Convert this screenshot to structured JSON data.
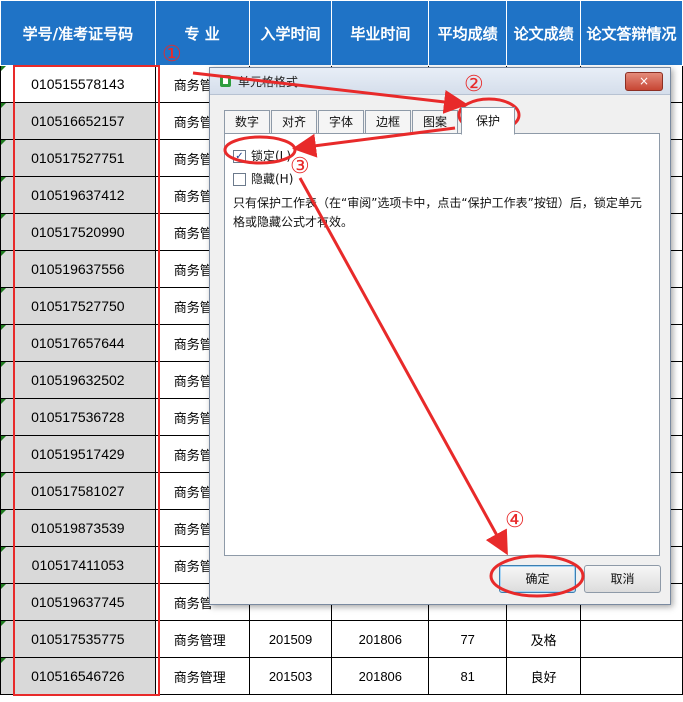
{
  "table": {
    "headers": [
      "学号/准考证号码",
      "专  业",
      "入学时间",
      "毕业时间",
      "平均成绩",
      "论文成绩",
      "论文答辩情况"
    ],
    "rows": [
      {
        "id": "010515578143",
        "major": "商务管",
        "entry": "",
        "grad": "",
        "avg": "",
        "thesis": ""
      },
      {
        "id": "010516652157",
        "major": "商务管",
        "entry": "",
        "grad": "",
        "avg": "",
        "thesis": ""
      },
      {
        "id": "010517527751",
        "major": "商务管",
        "entry": "",
        "grad": "",
        "avg": "",
        "thesis": ""
      },
      {
        "id": "010519637412",
        "major": "商务管",
        "entry": "",
        "grad": "",
        "avg": "",
        "thesis": ""
      },
      {
        "id": "010517520990",
        "major": "商务管",
        "entry": "",
        "grad": "",
        "avg": "",
        "thesis": ""
      },
      {
        "id": "010519637556",
        "major": "商务管",
        "entry": "",
        "grad": "",
        "avg": "",
        "thesis": ""
      },
      {
        "id": "010517527750",
        "major": "商务管",
        "entry": "",
        "grad": "",
        "avg": "",
        "thesis": ""
      },
      {
        "id": "010517657644",
        "major": "商务管",
        "entry": "",
        "grad": "",
        "avg": "",
        "thesis": ""
      },
      {
        "id": "010519632502",
        "major": "商务管",
        "entry": "",
        "grad": "",
        "avg": "",
        "thesis": ""
      },
      {
        "id": "010517536728",
        "major": "商务管",
        "entry": "",
        "grad": "",
        "avg": "",
        "thesis": ""
      },
      {
        "id": "010519517429",
        "major": "商务管",
        "entry": "",
        "grad": "",
        "avg": "",
        "thesis": ""
      },
      {
        "id": "010517581027",
        "major": "商务管",
        "entry": "",
        "grad": "",
        "avg": "",
        "thesis": ""
      },
      {
        "id": "010519873539",
        "major": "商务管",
        "entry": "",
        "grad": "",
        "avg": "",
        "thesis": ""
      },
      {
        "id": "010517411053",
        "major": "商务管",
        "entry": "",
        "grad": "",
        "avg": "",
        "thesis": ""
      },
      {
        "id": "010519637745",
        "major": "商务管",
        "entry": "",
        "grad": "",
        "avg": "",
        "thesis": ""
      },
      {
        "id": "010517535775",
        "major": "商务管理",
        "entry": "201509",
        "grad": "201806",
        "avg": "77",
        "thesis": "及格"
      },
      {
        "id": "010516546726",
        "major": "商务管理",
        "entry": "201503",
        "grad": "201806",
        "avg": "81",
        "thesis": "良好"
      }
    ]
  },
  "dialog": {
    "title": "单元格格式",
    "close": "×",
    "tabs": [
      "数字",
      "对齐",
      "字体",
      "边框",
      "图案",
      "保护"
    ],
    "locked_label": "锁定(L)",
    "locked_checked": true,
    "hidden_label": "隐藏(H)",
    "hidden_checked": false,
    "info": "只有保护工作表（在“审阅”选项卡中，点击“保护工作表”按钮）后，锁定单元格或隐藏公式才有效。",
    "ok": "确定",
    "cancel": "取消"
  },
  "annotations": {
    "step1": "①",
    "step2": "②",
    "step3": "③",
    "step4": "④"
  },
  "colors": {
    "header_bg": "#1f73c6",
    "annotation_red": "#e82a2a",
    "id_cell_bg": "#d9d9d9"
  }
}
